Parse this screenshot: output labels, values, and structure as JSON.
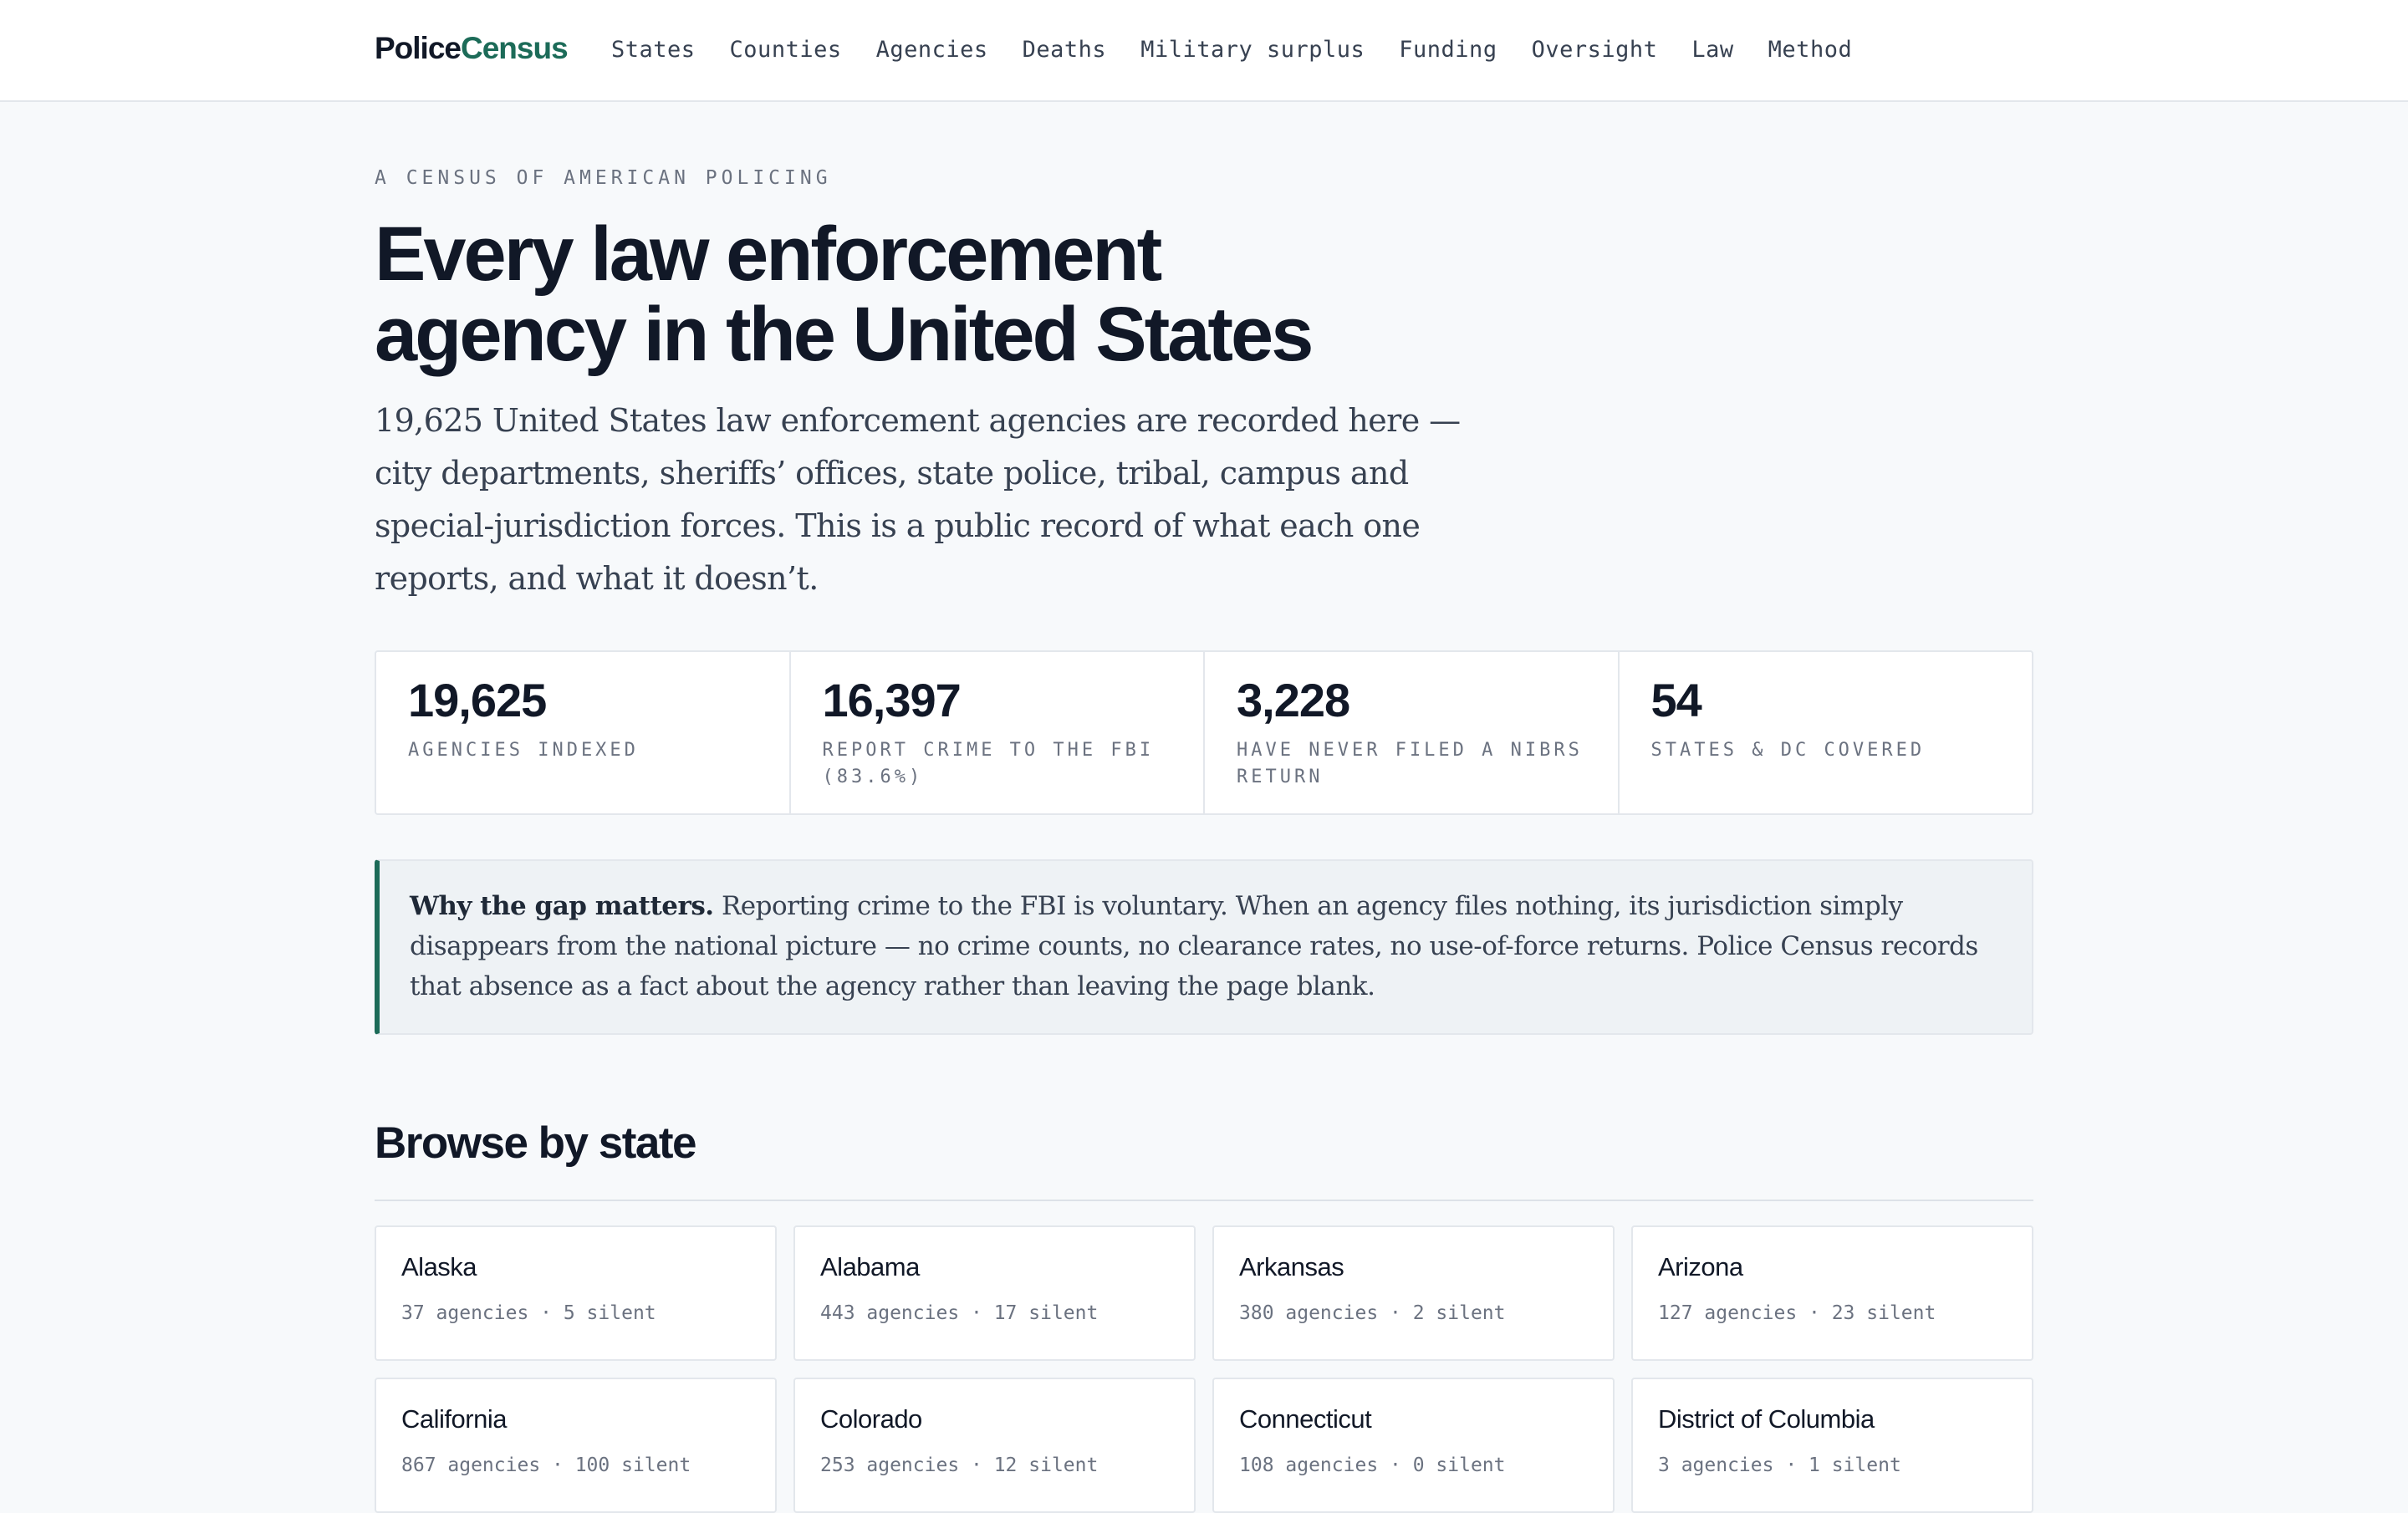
{
  "header": {
    "logo_part1": "Police",
    "logo_part2": "Census",
    "nav": [
      "States",
      "Counties",
      "Agencies",
      "Deaths",
      "Military surplus",
      "Funding",
      "Oversight",
      "Law",
      "Method"
    ]
  },
  "hero": {
    "eyebrow": "A CENSUS OF AMERICAN POLICING",
    "title_line1": "Every law enforcement",
    "title_line2": "agency in the United States",
    "lede": "19,625 United States law enforcement agencies are recorded here — city departments, sheriffs’ offices, state police, tribal, campus and special-jurisdiction forces. This is a public record of what each one reports, and what it doesn’t."
  },
  "stats": [
    {
      "value": "19,625",
      "label": "Agencies indexed"
    },
    {
      "value": "16,397",
      "label": "Report crime to the FBI (83.6%)"
    },
    {
      "value": "3,228",
      "label": "Have never filed a NIBRS return"
    },
    {
      "value": "54",
      "label": "States & DC covered"
    }
  ],
  "callout": {
    "lead": "Why the gap matters.",
    "body": " Reporting crime to the FBI is voluntary. When an agency files nothing, its jurisdiction simply disappears from the national picture — no crime counts, no clearance rates, no use-of-force returns. Police Census records that absence as a fact about the agency rather than leaving the page blank."
  },
  "browse": {
    "title": "Browse by state",
    "states": [
      {
        "name": "Alaska",
        "meta": "37 agencies · 5 silent"
      },
      {
        "name": "Alabama",
        "meta": "443 agencies · 17 silent"
      },
      {
        "name": "Arkansas",
        "meta": "380 agencies · 2 silent"
      },
      {
        "name": "Arizona",
        "meta": "127 agencies · 23 silent"
      },
      {
        "name": "California",
        "meta": "867 agencies · 100 silent"
      },
      {
        "name": "Colorado",
        "meta": "253 agencies · 12 silent"
      },
      {
        "name": "Connecticut",
        "meta": "108 agencies · 0 silent"
      },
      {
        "name": "District of Columbia",
        "meta": "3 agencies · 1 silent"
      }
    ]
  }
}
